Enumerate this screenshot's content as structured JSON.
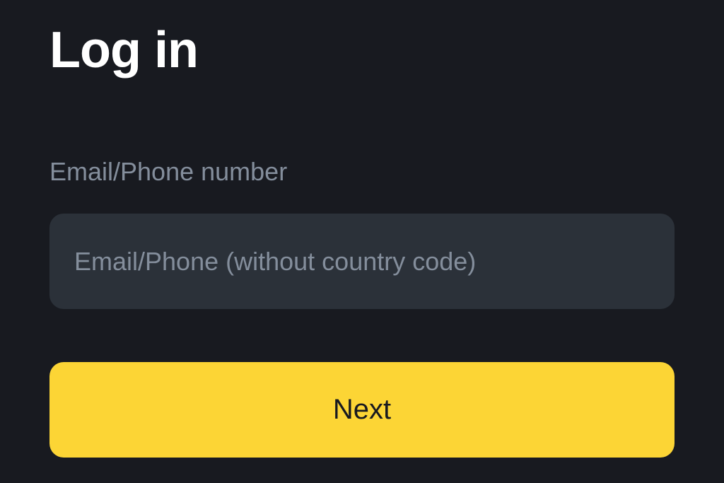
{
  "login": {
    "title": "Log in",
    "field_label": "Email/Phone number",
    "input_placeholder": "Email/Phone (without country code)",
    "input_value": "",
    "next_button_label": "Next"
  },
  "colors": {
    "background": "#181a20",
    "input_bg": "#2b3139",
    "text_primary": "#ffffff",
    "text_secondary": "#848e9c",
    "accent": "#fcd535"
  }
}
